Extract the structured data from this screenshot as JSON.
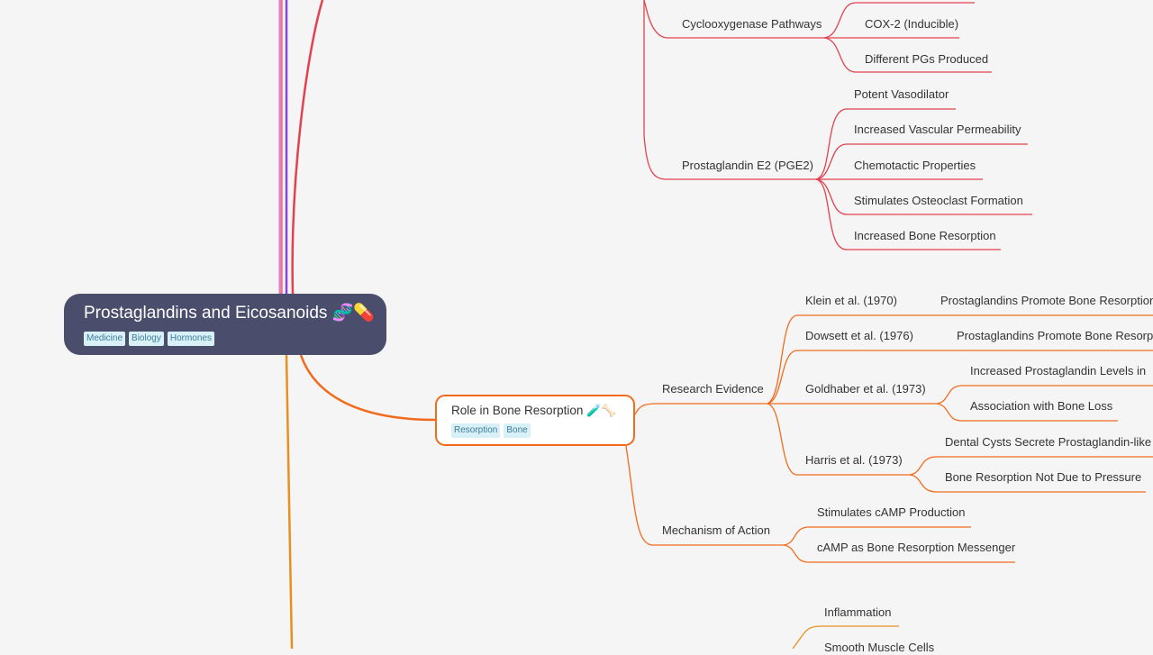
{
  "root": {
    "title": "Prostaglandins and Eicosanoids 🧬💊",
    "tags": [
      "Medicine",
      "Biology",
      "Hormones"
    ]
  },
  "colors": {
    "root_bg": "#4a4d6b",
    "red_branch": "#e2424f",
    "orange_branch": "#f26b1d",
    "amber_branch": "#e8901f",
    "purple_branch": "#8a3ff0",
    "pink_branch": "#e67bc6",
    "tag_bg": "#d8f0f7",
    "tag_text": "#3e7e96"
  },
  "red_branch": {
    "cox": {
      "label": "Cyclooxygenase Pathways",
      "children": [
        "COX-2 (Inducible)",
        "Different PGs Produced"
      ]
    },
    "pge2": {
      "label": "Prostaglandin E2 (PGE2)",
      "children": [
        "Potent Vasodilator",
        "Increased Vascular Permeability",
        "Chemotactic Properties",
        "Stimulates Osteoclast Formation",
        "Increased Bone Resorption"
      ]
    }
  },
  "bone": {
    "title": "Role in Bone Resorption 🧪🦴",
    "tags": [
      "Resorption",
      "Bone"
    ],
    "research": {
      "label": "Research Evidence",
      "studies": [
        {
          "label": "Klein et al. (1970)",
          "children": [
            "Prostaglandins Promote Bone Resorption"
          ]
        },
        {
          "label": "Dowsett et al. (1976)",
          "children": [
            "Prostaglandins Promote Bone Resorption"
          ]
        },
        {
          "label": "Goldhaber et al. (1973)",
          "children": [
            "Increased Prostaglandin Levels in",
            "Association with Bone Loss"
          ]
        },
        {
          "label": "Harris et al. (1973)",
          "children": [
            "Dental Cysts Secrete Prostaglandin-like",
            "Bone Resorption Not Due to Pressure"
          ]
        }
      ]
    },
    "mechanism": {
      "label": "Mechanism of Action",
      "children": [
        "Stimulates cAMP Production",
        "cAMP as Bone Resorption Messenger"
      ]
    }
  },
  "amber_branch": {
    "children": [
      "Inflammation",
      "Smooth Muscle Cells"
    ]
  }
}
